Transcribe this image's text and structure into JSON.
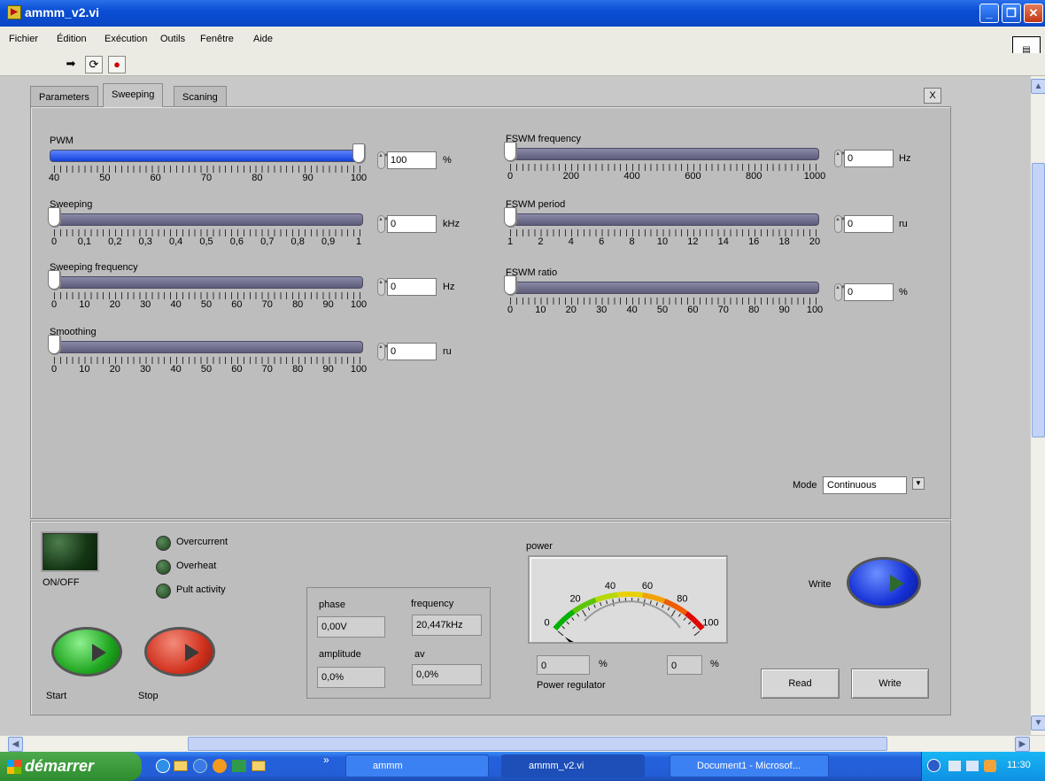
{
  "window": {
    "title": "ammm_v2.vi"
  },
  "menu": [
    "Fichier",
    "Édition",
    "Exécution",
    "Outils",
    "Fenêtre",
    "Aide"
  ],
  "tabs": [
    "Parameters",
    "Sweeping",
    "Scaning"
  ],
  "close_label": "X",
  "sliders_left": [
    {
      "label": "PWM",
      "value": "100",
      "unit": "%",
      "fraction": 1.0,
      "filled": true,
      "ticks": [
        "40",
        "50",
        "60",
        "70",
        "80",
        "90",
        "100"
      ]
    },
    {
      "label": "Sweeping",
      "value": "0",
      "unit": "kHz",
      "fraction": 0,
      "filled": false,
      "ticks": [
        "0",
        "0,1",
        "0,2",
        "0,3",
        "0,4",
        "0,5",
        "0,6",
        "0,7",
        "0,8",
        "0,9",
        "1"
      ]
    },
    {
      "label": "Sweeping frequency",
      "value": "0",
      "unit": "Hz",
      "fraction": 0,
      "filled": false,
      "ticks": [
        "0",
        "10",
        "20",
        "30",
        "40",
        "50",
        "60",
        "70",
        "80",
        "90",
        "100"
      ]
    },
    {
      "label": "Smoothing",
      "value": "0",
      "unit": "ru",
      "fraction": 0,
      "filled": false,
      "ticks": [
        "0",
        "10",
        "20",
        "30",
        "40",
        "50",
        "60",
        "70",
        "80",
        "90",
        "100"
      ]
    }
  ],
  "sliders_right": [
    {
      "label": "FSWM frequency",
      "value": "0",
      "unit": "Hz",
      "fraction": 0,
      "filled": false,
      "ticks": [
        "0",
        "200",
        "400",
        "600",
        "800",
        "1000"
      ]
    },
    {
      "label": "FSWM period",
      "value": "0",
      "unit": "ru",
      "fraction": 0,
      "filled": false,
      "ticks": [
        "1",
        "2",
        "4",
        "6",
        "8",
        "10",
        "12",
        "14",
        "16",
        "18",
        "20"
      ]
    },
    {
      "label": "FSWM ratio",
      "value": "0",
      "unit": "%",
      "fraction": 0,
      "filled": false,
      "ticks": [
        "0",
        "10",
        "20",
        "30",
        "40",
        "50",
        "60",
        "70",
        "80",
        "90",
        "100"
      ]
    }
  ],
  "mode": {
    "label": "Mode",
    "value": "Continuous"
  },
  "lower": {
    "onoff_label": "ON/OFF",
    "leds": [
      "Overcurrent",
      "Overheat",
      "Pult activity"
    ],
    "start_label": "Start",
    "stop_label": "Stop",
    "indicators": {
      "phase_label": "phase",
      "phase_value": "0,00V",
      "frequency_label": "frequency",
      "frequency_value": "20,447kHz",
      "amplitude_label": "amplitude",
      "amplitude_value": "0,0%",
      "av_label": "av",
      "av_value": "0,0%"
    },
    "power_label": "power",
    "gauge_ticks": [
      "0",
      "20",
      "40",
      "60",
      "80",
      "100"
    ],
    "gauge_value": 0,
    "power_reg_value1": "0",
    "power_reg_unit1": "%",
    "power_reg_value2": "0",
    "power_reg_unit2": "%",
    "power_reg_label": "Power regulator",
    "write_label_top": "Write",
    "read_button": "Read",
    "write_button": "Write"
  },
  "taskbar": {
    "start": "démarrer",
    "chevron": "»",
    "items": [
      "ammm",
      "ammm_v2.vi",
      "Document1 - Microsof..."
    ],
    "clock": "11:30"
  }
}
